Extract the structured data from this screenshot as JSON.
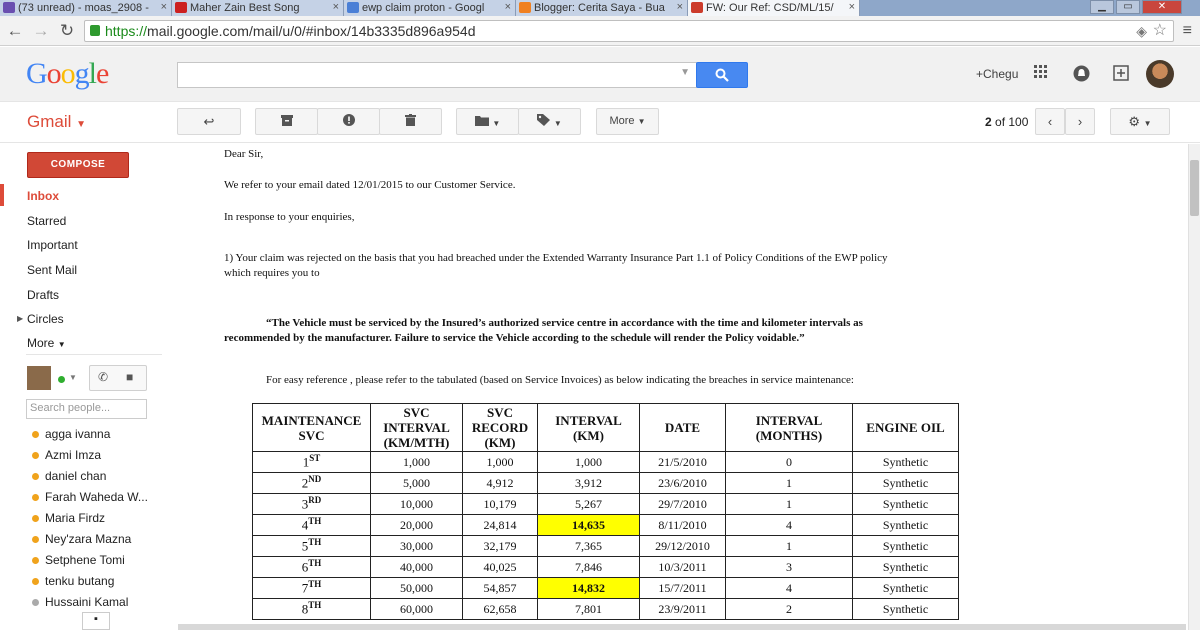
{
  "tabs": [
    {
      "label": "(73 unread) - moas_2908 -",
      "color": "#6a4fb0"
    },
    {
      "label": "Maher Zain Best Song",
      "color": "#cc2020"
    },
    {
      "label": "ewp claim proton - Googl",
      "color": "#4a7fd6"
    },
    {
      "label": "Blogger: Cerita Saya - Bua",
      "color": "#f08020"
    },
    {
      "label": "FW: Our Ref: CSD/ML/15/",
      "color": "#cc3b2b"
    }
  ],
  "address": {
    "scheme": "https://",
    "host_path": "mail.google.com/mail/u/0/#inbox/14b3335d896a954d"
  },
  "header": {
    "logo": "Google",
    "plus_user": "+Chegu"
  },
  "gmail": {
    "label": "Gmail",
    "more_label": "More",
    "page_current": "2",
    "page_of": "of 100"
  },
  "sidebar": {
    "compose_label": "COMPOSE",
    "items": [
      "Inbox",
      "Starred",
      "Important",
      "Sent Mail",
      "Drafts",
      "Circles",
      "More"
    ],
    "search_placeholder": "Search people...",
    "contacts": [
      "agga ivanna",
      "Azmi Imza",
      "daniel chan",
      "Farah Waheda W...",
      "Maria Firdz",
      "Ney'zara Mazna",
      "Setphene Tomi",
      "tenku butang",
      "Hussaini Kamal"
    ]
  },
  "message": {
    "greeting": "Dear Sir,",
    "p1": "We refer to your email dated 12/01/2015 to our Customer Service.",
    "p2": "In response to your enquiries,",
    "p3_line1": "1)    Your claim was rejected on the basis that you had breached under the Extended Warranty Insurance Part 1.1 of Policy Conditions of the EWP policy",
    "p3_line2": "which requires you to",
    "quote_line1": "“The Vehicle must be serviced by the Insured’s authorized service centre in accordance with the time and kilometer intervals as",
    "quote_line2": "recommended by the manufacturer. Failure to service the   Vehicle according to the schedule will render the Policy voidable.”",
    "p4": "For easy reference , please refer to the tabulated (based on Service Invoices) as below indicating the breaches in service maintenance:"
  },
  "table": {
    "headers": [
      "MAINTENANCE SVC",
      "SVC INTERVAL (KM/MTH)",
      "SVC RECORD (KM)",
      "INTERVAL (KM)",
      "DATE",
      "INTERVAL (MONTHS)",
      "ENGINE OIL"
    ],
    "rows": [
      {
        "num": "1",
        "suf": "ST",
        "interval": "1,000",
        "record": "1,000",
        "km": "1,000",
        "date": "21/5/2010",
        "months": "0",
        "oil": "Synthetic",
        "highlight": false
      },
      {
        "num": "2",
        "suf": "ND",
        "interval": "5,000",
        "record": "4,912",
        "km": "3,912",
        "date": "23/6/2010",
        "months": "1",
        "oil": "Synthetic",
        "highlight": false
      },
      {
        "num": "3",
        "suf": "RD",
        "interval": "10,000",
        "record": "10,179",
        "km": "5,267",
        "date": "29/7/2010",
        "months": "1",
        "oil": "Synthetic",
        "highlight": false
      },
      {
        "num": "4",
        "suf": "TH",
        "interval": "20,000",
        "record": "24,814",
        "km": "14,635",
        "date": "8/11/2010",
        "months": "4",
        "oil": "Synthetic",
        "highlight": true
      },
      {
        "num": "5",
        "suf": "TH",
        "interval": "30,000",
        "record": "32,179",
        "km": "7,365",
        "date": "29/12/2010",
        "months": "1",
        "oil": "Synthetic",
        "highlight": false
      },
      {
        "num": "6",
        "suf": "TH",
        "interval": "40,000",
        "record": "40,025",
        "km": "7,846",
        "date": "10/3/2011",
        "months": "3",
        "oil": "Synthetic",
        "highlight": false
      },
      {
        "num": "7",
        "suf": "TH",
        "interval": "50,000",
        "record": "54,857",
        "km": "14,832",
        "date": "15/7/2011",
        "months": "4",
        "oil": "Synthetic",
        "highlight": true
      },
      {
        "num": "8",
        "suf": "TH",
        "interval": "60,000",
        "record": "62,658",
        "km": "7,801",
        "date": "23/9/2011",
        "months": "2",
        "oil": "Synthetic",
        "highlight": false
      }
    ]
  },
  "colors": {
    "gmail_red": "#dd4b39",
    "compose": "#d14836",
    "search_blue": "#4889f1",
    "highlight": "#ffff00"
  }
}
